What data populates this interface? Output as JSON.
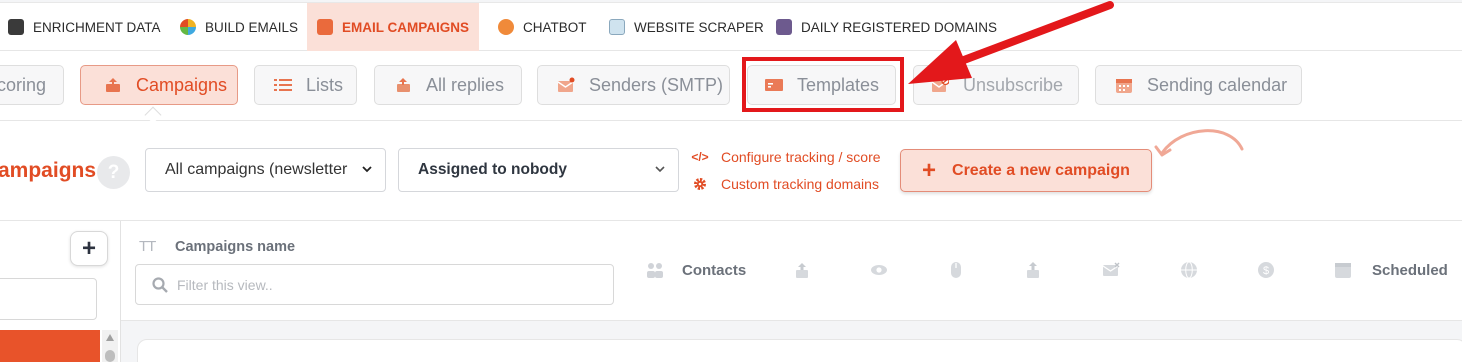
{
  "topnav": {
    "items": [
      {
        "label": "ENRICHMENT DATA",
        "icon": "enrichment-icon"
      },
      {
        "label": "BUILD EMAILS",
        "icon": "build-emails-icon"
      },
      {
        "label": "EMAIL CAMPAIGNS",
        "icon": "email-campaigns-icon",
        "active": true
      },
      {
        "label": "CHATBOT",
        "icon": "chatbot-icon"
      },
      {
        "label": "WEBSITE SCRAPER",
        "icon": "website-scraper-icon"
      },
      {
        "label": "DAILY REGISTERED DOMAINS",
        "icon": "daily-domains-icon"
      }
    ]
  },
  "subnav": {
    "items": [
      {
        "label": "Scoring",
        "visible_label": "coring",
        "icon": "scoring-icon"
      },
      {
        "label": "Campaigns",
        "icon": "campaigns-icon",
        "active": true
      },
      {
        "label": "Lists",
        "icon": "list-icon"
      },
      {
        "label": "All replies",
        "icon": "replies-icon"
      },
      {
        "label": "Senders (SMTP)",
        "icon": "senders-icon"
      },
      {
        "label": "Templates",
        "icon": "templates-icon",
        "highlighted": true
      },
      {
        "label": "Unsubscribe",
        "icon": "unsubscribe-icon"
      },
      {
        "label": "Sending calendar",
        "icon": "calendar-icon"
      }
    ]
  },
  "header": {
    "title": "ampaigns",
    "help_label": "?",
    "campaign_filter": "All campaigns (newsletter",
    "assignee_filter": "Assigned to nobody",
    "configure_tracking": "Configure tracking / score",
    "custom_domains": "Custom tracking domains",
    "create_button": "Create a new campaign"
  },
  "left_panel": {
    "add_label": "+"
  },
  "table": {
    "name_col_icon_text": "TT",
    "name_col": "Campaigns name",
    "filter_placeholder": "Filter this view..",
    "contacts": "Contacts",
    "scheduled": "Scheduled",
    "column_icons": [
      "contacts-icon",
      "sent-icon",
      "opened-icon",
      "clicked-icon",
      "replied-icon",
      "bounced-icon",
      "web-visit-icon",
      "revenue-icon",
      "scheduled-icon"
    ]
  },
  "colors": {
    "accent": "#e14c24",
    "accent_bg": "#fbe0d8",
    "annotation_red": "#e3181b",
    "annotation_curve": "#f0a896"
  }
}
